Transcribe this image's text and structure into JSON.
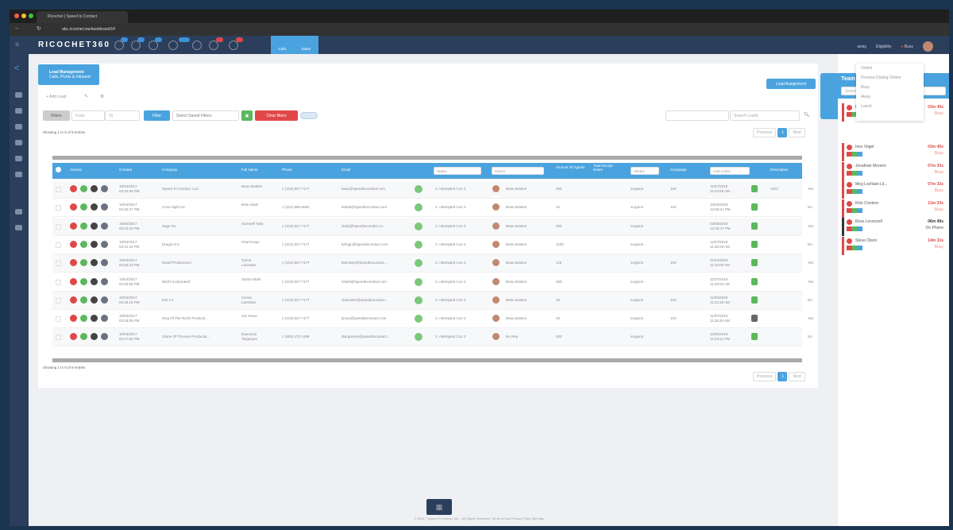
{
  "browser": {
    "tab_title": "Ricochet | Speed to Contact",
    "url": "abc.ricochet.me/dashboard2/#"
  },
  "app": {
    "logo": "RICOCHET360",
    "nav_tabs": [
      "Calls",
      "Dialer"
    ],
    "nav_right": [
      "away",
      "Eligibility",
      "Busy"
    ],
    "status_menu": [
      "Online",
      "Preview Dialing Online",
      "Busy",
      "Away",
      "Lunch"
    ]
  },
  "page": {
    "title": "Lead Management",
    "subtitle": "Calls, Pivots & Inbound",
    "lead_assignment_button": "Lead Assignment",
    "toolbar": {
      "add_lead": "Add Lead",
      "filters": "Filters",
      "from_placeholder": "From",
      "to_placeholder": "To",
      "filter_button": "Filter",
      "saved_filters": "Select Saved Filters",
      "clear_filters": "Clear filters",
      "search_placeholder": "Search Leads"
    },
    "showing_top": "Showing 1 to 9 of 9 entries",
    "showing_bottom": "Showing 1 to 9 of 9 entries",
    "pagination": {
      "previous": "Previous",
      "page": "1",
      "next": "Next"
    }
  },
  "table": {
    "headers": {
      "actions": "Actions",
      "created": "Created",
      "company": "Company",
      "fullname": "Full Name",
      "phone": "Phone",
      "email": "Email",
      "status": "Status",
      "owner": "Owner",
      "amount": "Amount Of Agents",
      "notes": "Total Recipe Notes",
      "vendor": "Vendor",
      "campaign": "Campaign",
      "last_action": "Last Action",
      "description": "Description",
      "source": "Home Loan"
    },
    "rows": [
      {
        "created": "10/04/2017 03:34:46 PM",
        "company": "Speed To Contact, LLC",
        "name": "Beau Bratton",
        "phone": "1 (313) 827-7177",
        "email": "beau@speedtocontact.com",
        "status": "2. Attempted Con 2",
        "owner": "Beau Bratton",
        "amount": "300",
        "vendor": "surgeon",
        "campaign": "104",
        "last": "11/07/2019 11:24:55 AM",
        "desc": "CEO",
        "src": "Yes"
      },
      {
        "created": "10/04/2017 03:26:27 PM",
        "company": "Crow Sight Inc",
        "name": "Bran Stark",
        "phone": "1 (313) 985-8080",
        "email": "bstark@speedtocontact.com",
        "status": "2. Attempted Con 3",
        "owner": "Beau Bratton",
        "amount": "10",
        "vendor": "surgeon",
        "campaign": "104",
        "last": "16/03/2019 12:50:21 PM",
        "desc": "",
        "src": "No"
      },
      {
        "created": "10/04/2017 03:22:22 PM",
        "company": "Sage Inc",
        "name": "Samwell Tarly",
        "phone": "1 (313) 827-7177",
        "email": "starly@speedtocontact.co...",
        "status": "2. Attempted Con 2",
        "owner": "Beau Bratton",
        "amount": "200",
        "vendor": "surgeon",
        "campaign": "",
        "last": "02/06/2019 12:49:47 PM",
        "desc": "",
        "src": "Yes"
      },
      {
        "created": "10/04/2017 03:21:22 PM",
        "company": "Dragon Inc",
        "name": "Khal Drogo",
        "phone": "1 (313) 827-7177",
        "email": "kdrogo@speedtocontact.com",
        "status": "2. Attempted Con 2",
        "owner": "Beau Bratton",
        "amount": "1100",
        "vendor": "surgeon",
        "campaign": "",
        "last": "11/07/2019 11:25:03 AM",
        "desc": "",
        "src": "No"
      },
      {
        "created": "10/04/2017 03:20:43 PM",
        "company": "Dwarf Productions",
        "name": "Tyrion Lannister",
        "phone": "1 (313) 827-7177",
        "email": "tlannister@speedtocontact...",
        "status": "2. Attempted Con 3",
        "owner": "Beau Bratton",
        "amount": "115",
        "vendor": "surgeon",
        "campaign": "104",
        "last": "01/04/2019 11:33:05 AM",
        "desc": "",
        "src": "Yes"
      },
      {
        "created": "10/04/2017 03:20:05 PM",
        "company": "Wolf Incorporated",
        "name": "Sansa Stark",
        "phone": "1 (313) 827-7177",
        "email": "sstark@speedtocontact.com",
        "status": "2. Attempted Con 2",
        "owner": "Beau Bratton",
        "amount": "300",
        "vendor": "surgeon",
        "campaign": "",
        "last": "11/07/2019 11:23:04 AM",
        "desc": "",
        "src": "Yes"
      },
      {
        "created": "10/04/2017 03:19:16 PM",
        "company": "Evil Co",
        "name": "Cersei Lannister",
        "phone": "1 (313) 827-7177",
        "email": "clannister@speedtocontact...",
        "status": "2. Attempted Con 3",
        "owner": "Beau Bratton",
        "amount": "10",
        "vendor": "surgeon",
        "campaign": "104",
        "last": "11/05/2019 11:24:20 AM",
        "desc": "",
        "src": "No"
      },
      {
        "created": "10/04/2017 03:18:08 PM",
        "company": "King Of The North Producti...",
        "name": "Jon Snow",
        "phone": "1 (313) 827-7177",
        "email": "jsnow@speedtocontact.com",
        "status": "2. Attempted Con 2",
        "owner": "Beau Bratton",
        "amount": "40",
        "vendor": "surgeon",
        "campaign": "104",
        "last": "11/07/2019 11:26:44 AM",
        "desc": "",
        "src": "Yes"
      },
      {
        "created": "10/04/2017 03:17:52 PM",
        "company": "Game Of Thrones Productio...",
        "name": "Daenerys Targaryen",
        "phone": "1 (800) 270-1288",
        "email": "dtargaryen@speedtocontact...",
        "status": "2. Attempted Con 2",
        "owner": "No Rep",
        "amount": "200",
        "vendor": "surgeon",
        "campaign": "",
        "last": "11/05/2019 11:24:21 PM",
        "desc": "",
        "src": "No"
      }
    ]
  },
  "team": {
    "title": "Team",
    "search_placeholder": "Search Teams",
    "agents": [
      {
        "name": "Beau Bratton",
        "time": "03m 49s",
        "state": "Busy"
      },
      {
        "name": "Ines Vogel",
        "time": "03m 46s",
        "state": "Busy"
      },
      {
        "name": "Jonathan Moreno",
        "time": "07m 33s",
        "state": "Busy"
      },
      {
        "name": "Meg Lochlain Lil...",
        "time": "07m 33s",
        "state": "Busy"
      },
      {
        "name": "Rick Cordero",
        "time": "12m 33s",
        "state": "Busy"
      },
      {
        "name": "Ross Lococoell",
        "time": "06m 49s",
        "state": "On Phone"
      },
      {
        "name": "Steve Olson",
        "time": "14m 33s",
        "state": "Busy"
      }
    ]
  },
  "footer": "© 2019 - Speed To Contact, Inc. - All Rights Reserved. Terms of Use Privacy Policy Site Map",
  "colors": {
    "primary": "#4aa3df",
    "danger": "#e04848",
    "success": "#5cb85c",
    "nav": "#2b3f5c"
  }
}
